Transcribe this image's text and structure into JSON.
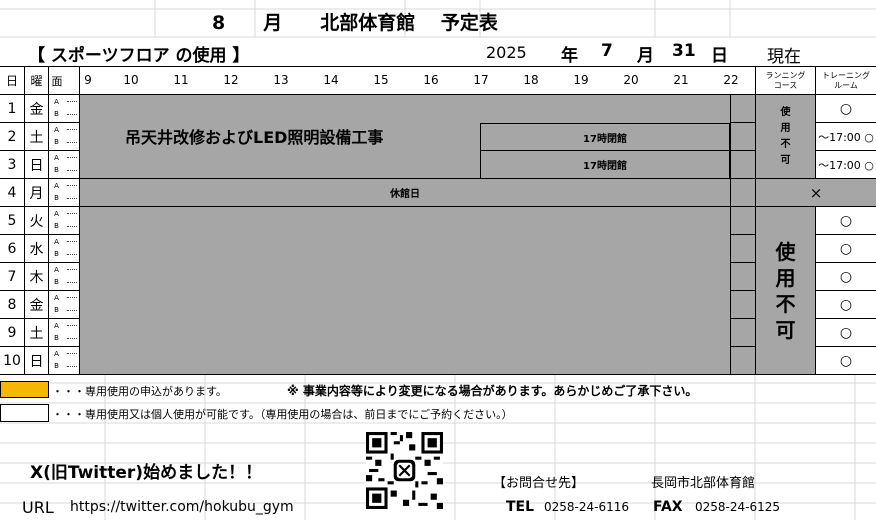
{
  "header": {
    "title": "8　　月　　北部体育館　 予定表",
    "subtitle": "【 スポーツフロア の使用 】",
    "year": "2025",
    "year_label": "年",
    "month": "7",
    "month_label": "月",
    "day": "31",
    "day_label": "日",
    "now_label": "現在"
  },
  "columns": {
    "day": "日",
    "weekday": "曜",
    "slot": "面",
    "hours": [
      "9",
      "10",
      "11",
      "12",
      "13",
      "14",
      "15",
      "16",
      "17",
      "18",
      "19",
      "20",
      "21",
      "22"
    ],
    "running": "ランニング\nコース",
    "training": "トレーニング\nルーム"
  },
  "rows": [
    {
      "day": "1",
      "weekday": "金",
      "training": "○"
    },
    {
      "day": "2",
      "weekday": "土",
      "training": "～17:00 ○"
    },
    {
      "day": "3",
      "weekday": "日",
      "training": "～17:00 ○"
    },
    {
      "day": "4",
      "weekday": "月",
      "training": ""
    },
    {
      "day": "5",
      "weekday": "火",
      "training": "○"
    },
    {
      "day": "6",
      "weekday": "水",
      "training": "○"
    },
    {
      "day": "7",
      "weekday": "木",
      "training": "○"
    },
    {
      "day": "8",
      "weekday": "金",
      "training": "○"
    },
    {
      "day": "9",
      "weekday": "土",
      "training": "○"
    },
    {
      "day": "10",
      "weekday": "日",
      "training": "○"
    }
  ],
  "ab": {
    "a": "A",
    "b": "B"
  },
  "events": {
    "ceiling_work": "吊天井改修およびLED照明設備工事",
    "close17_day2": "17時閉館",
    "close17_day3": "17時閉館",
    "closed_day": "休館日",
    "closed_mark": "×",
    "running_unavailable_1": "使\n用\n不\n可",
    "running_unavailable_2": "使\n用\n不\n可"
  },
  "legend": {
    "reserved": "・・・専用使用の申込があります。",
    "notice": "※ 事業内容等により変更になる場合があります。あらかじめご了承下さい。",
    "available": "・・・専用使用又は個人使用が可能です。（専用使用の場合は、前日までにご予約ください。）"
  },
  "colors": {
    "reserved": "#f5b800",
    "gray": "#a6a6a6"
  },
  "footer": {
    "twitter_start": "X(旧Twitter)始めました！！",
    "url_label": "URL",
    "url": "https://twitter.com/hokubu_gym",
    "contact_label": "【お問合せ先】",
    "org": "長岡市北部体育館",
    "tel_label": "TEL",
    "tel": "0258-24-6116",
    "fax_label": "FAX",
    "fax": "0258-24-6125",
    "qr_icon": "qr-code-icon"
  }
}
